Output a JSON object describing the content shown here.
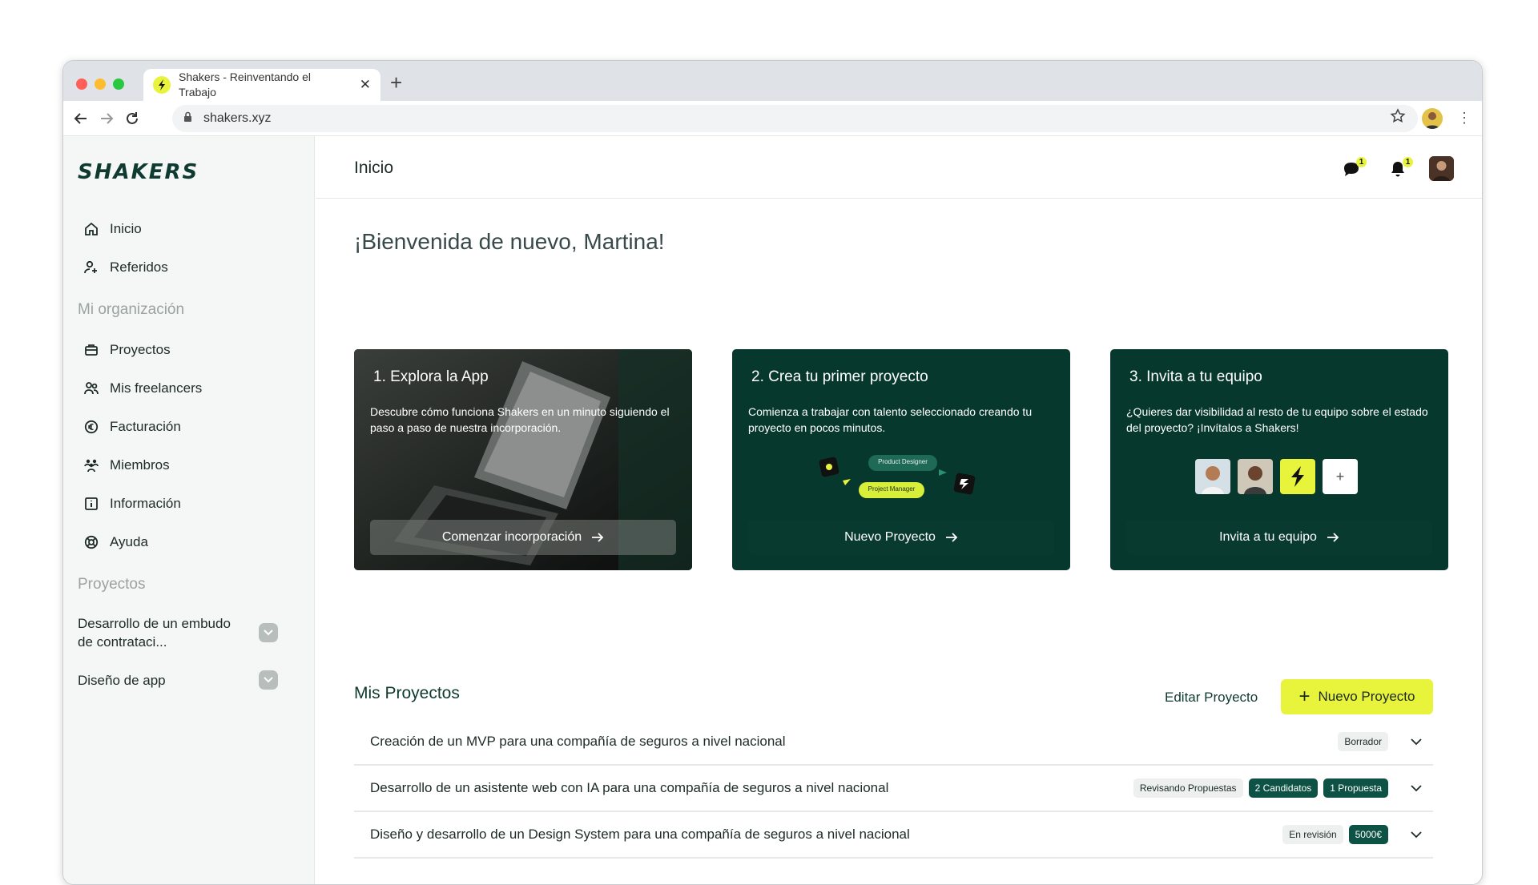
{
  "browser": {
    "tab_title": "Shakers - Reinventando el Trabajo",
    "url": "shakers.xyz",
    "traffic_lights": [
      "#ff5f57",
      "#febc2e",
      "#28c840"
    ]
  },
  "sidebar": {
    "logo": "SHAKERS",
    "items": [
      {
        "label": "Inicio",
        "icon": "home-icon"
      },
      {
        "label": "Referidos",
        "icon": "user-plus-icon"
      }
    ],
    "org_label": "Mi organización",
    "org_items": [
      {
        "label": "Proyectos",
        "icon": "briefcase-icon"
      },
      {
        "label": "Mis freelancers",
        "icon": "users-icon"
      },
      {
        "label": "Facturación",
        "icon": "euro-icon"
      },
      {
        "label": "Miembros",
        "icon": "team-icon"
      },
      {
        "label": "Información",
        "icon": "info-icon"
      },
      {
        "label": "Ayuda",
        "icon": "lifebuoy-icon"
      }
    ],
    "projects_label": "Proyectos",
    "projects": [
      {
        "label": "Desarrollo de un embudo de contrataci..."
      },
      {
        "label": "Diseño de app"
      }
    ]
  },
  "header": {
    "title": "Inicio",
    "chat_badge": "1",
    "bell_badge": "1"
  },
  "welcome": "¡Bienvenida de nuevo, Martina!",
  "cards": [
    {
      "title": "1. Explora la App",
      "desc": "Descubre cómo funciona Shakers en un minuto siguiendo el paso a paso de nuestra incorporación.",
      "button": "Comenzar incorporación"
    },
    {
      "title": "2. Crea tu primer proyecto",
      "desc": "Comienza a trabajar con talento seleccionado creando tu proyecto en pocos minutos.",
      "button": "Nuevo Proyecto",
      "chip_1": "Product Designer",
      "chip_2": "Project Manager"
    },
    {
      "title": "3. Invita a tu equipo",
      "desc": "¿Quieres dar visibilidad al resto de tu equipo sobre el estado del proyecto? ¡Invítalos a Shakers!",
      "button": "Invita a tu equipo",
      "add_symbol": "+"
    }
  ],
  "projects": {
    "title": "Mis Proyectos",
    "edit_label": "Editar Proyecto",
    "new_label": "Nuevo Proyecto",
    "rows": [
      {
        "title": "Creación de un MVP para una compañía de seguros a nivel nacional",
        "tags": [
          {
            "text": "Borrador",
            "style": "light"
          }
        ]
      },
      {
        "title": "Desarrollo de un asistente web con IA para una compañía de seguros a nivel nacional",
        "tags": [
          {
            "text": "Revisando Propuestas",
            "style": "light"
          },
          {
            "text": "2 Candidatos",
            "style": "dark"
          },
          {
            "text": "1 Propuesta",
            "style": "dark"
          }
        ]
      },
      {
        "title": "Diseño y desarrollo de un Design System para una compañía de seguros a nivel nacional",
        "tags": [
          {
            "text": "En revisión",
            "style": "light"
          },
          {
            "text": "5000€",
            "style": "dark"
          }
        ]
      }
    ]
  },
  "colors": {
    "brand_dark": "#07382e",
    "brand_yellow": "#e8f33b"
  }
}
